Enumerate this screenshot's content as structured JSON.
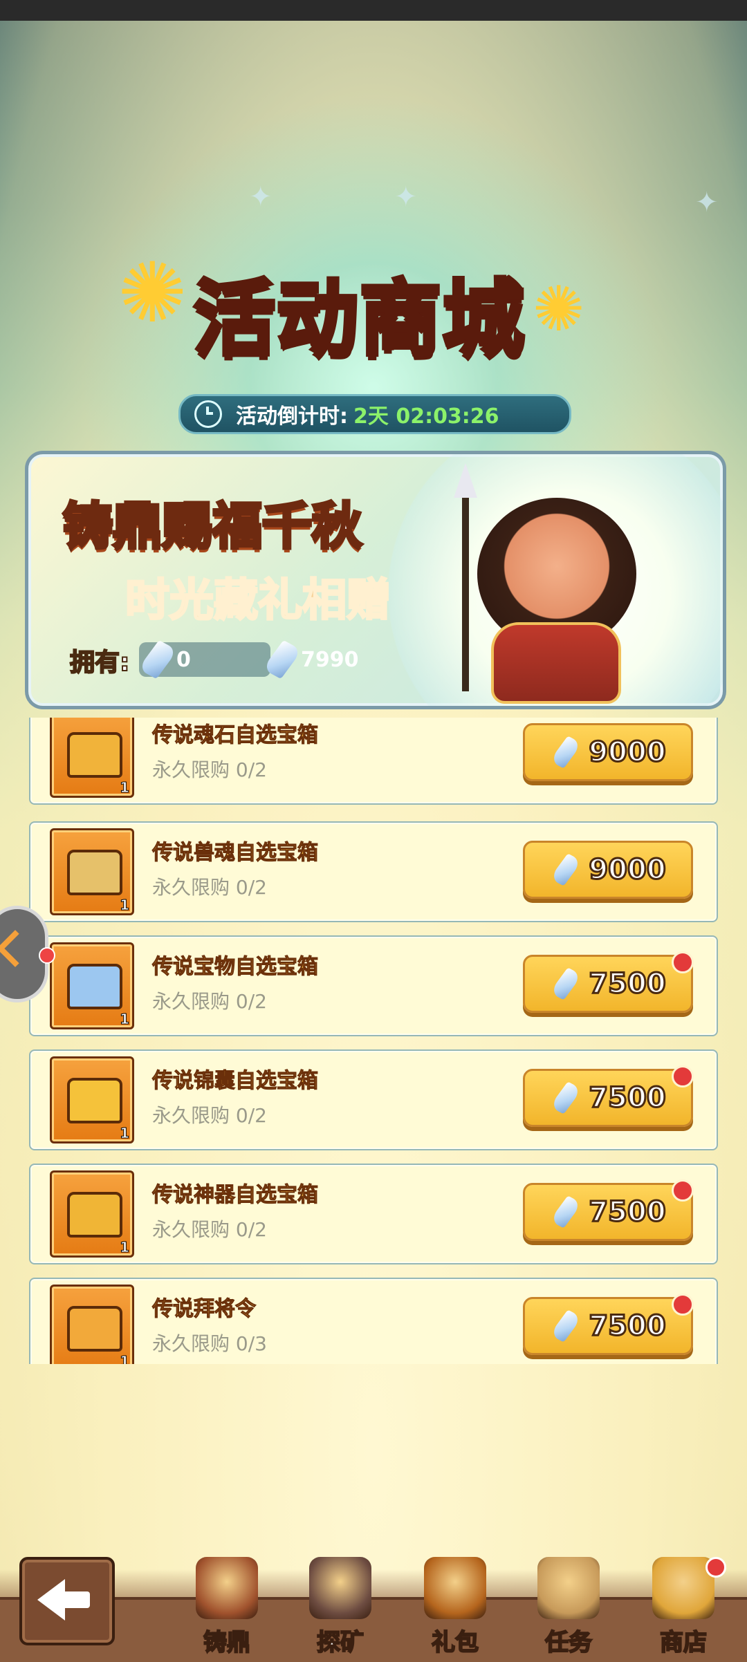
{
  "header": {
    "title": "活动商城",
    "countdown_label": "活动倒计时:",
    "countdown_value": "2天 02:03:26"
  },
  "banner": {
    "title": "铸鼎赐福千秋",
    "subtitle": "时光藏礼相赠",
    "own_label": "拥有:",
    "currency_1_amount": "0",
    "currency_2_amount": "7990"
  },
  "shop_items": [
    {
      "name": "传说魂石自选宝箱",
      "limit": "永久限购  0/2",
      "price": "9000",
      "qty": "1",
      "has_dot": false,
      "color": "#f1b33a"
    },
    {
      "name": "传说兽魂自选宝箱",
      "limit": "永久限购  0/2",
      "price": "9000",
      "qty": "1",
      "has_dot": false,
      "color": "#e6c16a"
    },
    {
      "name": "传说宝物自选宝箱",
      "limit": "永久限购  0/2",
      "price": "7500",
      "qty": "1",
      "has_dot": true,
      "color": "#9cc7f0"
    },
    {
      "name": "传说锦囊自选宝箱",
      "limit": "永久限购  0/2",
      "price": "7500",
      "qty": "1",
      "has_dot": true,
      "color": "#f5c23a"
    },
    {
      "name": "传说神器自选宝箱",
      "limit": "永久限购  0/2",
      "price": "7500",
      "qty": "1",
      "has_dot": true,
      "color": "#f0b536"
    },
    {
      "name": "传说拜将令",
      "limit": "永久限购  0/3",
      "price": "7500",
      "qty": "1",
      "has_dot": true,
      "color": "#f2a93a"
    }
  ],
  "nav": {
    "tabs": [
      {
        "label": "铸鼎",
        "icon": "cauldron-icon",
        "color": "#a0522d"
      },
      {
        "label": "探矿",
        "icon": "pickaxe-icon",
        "color": "#6d4c41"
      },
      {
        "label": "礼包",
        "icon": "gift-bag-icon",
        "color": "#b5651d"
      },
      {
        "label": "任务",
        "icon": "task-scroll-icon",
        "color": "#c79a5a"
      },
      {
        "label": "商店",
        "icon": "shop-icon",
        "color": "#e0a63a"
      }
    ]
  }
}
